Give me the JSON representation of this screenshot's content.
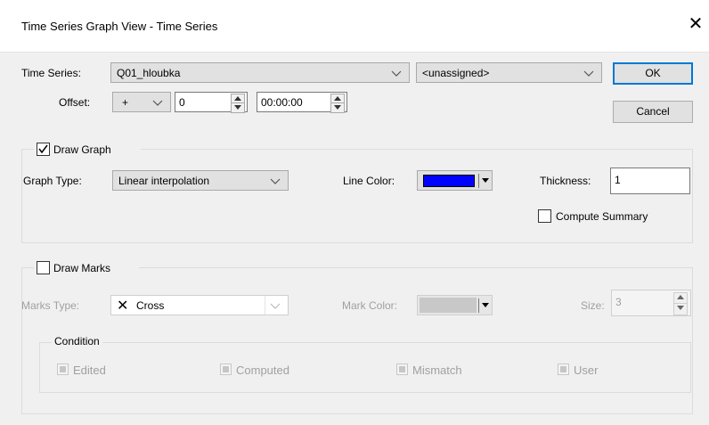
{
  "window": {
    "title": "Time Series Graph View - Time Series",
    "close_glyph": "✕"
  },
  "series_row": {
    "label": "Time Series:",
    "series_value": "Q01_hloubka",
    "secondary_value": "<unassigned>"
  },
  "offset_row": {
    "label": "Offset:",
    "sign_value": "+",
    "number_value": "0",
    "time_value": "00:00:00"
  },
  "buttons": {
    "ok": "OK",
    "cancel": "Cancel"
  },
  "draw_graph": {
    "label": "Draw Graph",
    "checked": true,
    "graph_type_label": "Graph Type:",
    "graph_type_value": "Linear interpolation",
    "line_color_label": "Line Color:",
    "line_color": "#0000ff",
    "thickness_label": "Thickness:",
    "thickness_value": "1",
    "summary_label": "Compute Summary"
  },
  "draw_marks": {
    "label": "Draw Marks",
    "checked": false,
    "marks_type_label": "Marks Type:",
    "marks_type_icon": "✕",
    "marks_type_value": "Cross",
    "mark_color_label": "Mark Color:",
    "mark_color": "#c8c8c8",
    "size_label": "Size:",
    "size_value": "3",
    "condition_label": "Condition",
    "conditions": [
      "Edited",
      "Computed",
      "Mismatch",
      "User"
    ]
  },
  "colors": {
    "accent": "#0078d7",
    "disabled_text": "#a0a0a0"
  }
}
